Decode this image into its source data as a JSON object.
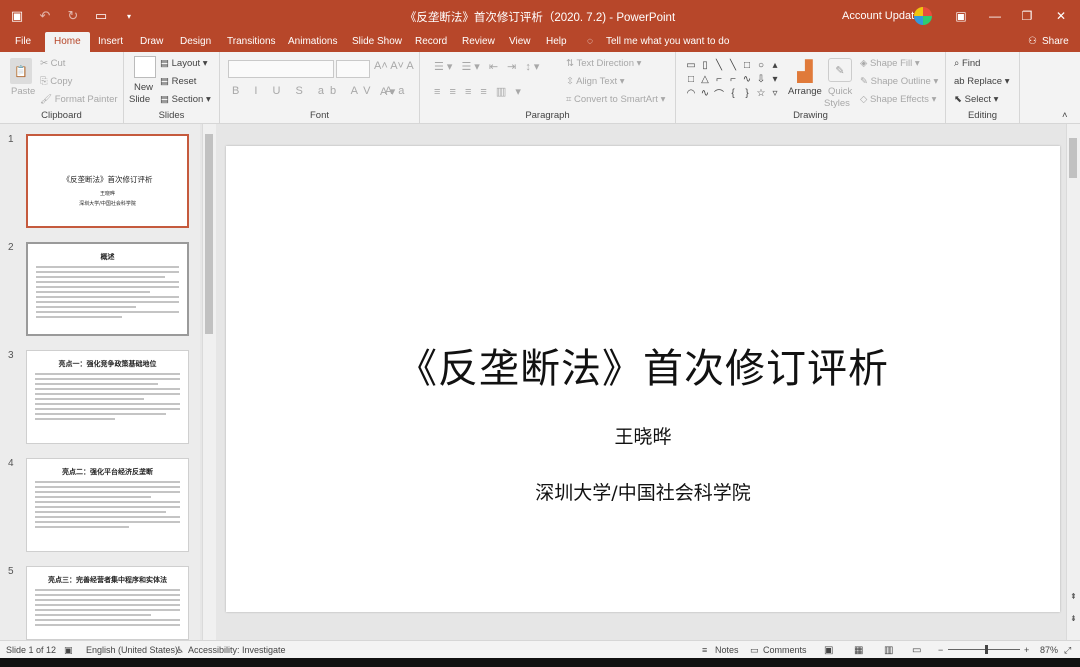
{
  "window": {
    "title": "《反垄断法》首次修订评析（2020. 7.2)  -  PowerPoint",
    "account": "Account Update"
  },
  "tabs": [
    "File",
    "Home",
    "Insert",
    "Draw",
    "Design",
    "Transitions",
    "Animations",
    "Slide Show",
    "Record",
    "Review",
    "View",
    "Help"
  ],
  "tell_me": "Tell me what you want to do",
  "share": "Share",
  "ribbon": {
    "clipboard": {
      "paste": "Paste",
      "cut": "Cut",
      "copy": "Copy",
      "format_painter": "Format Painter",
      "label": "Clipboard"
    },
    "slides": {
      "new_slide_1": "New",
      "new_slide_2": "Slide",
      "layout": "Layout",
      "reset": "Reset",
      "section": "Section",
      "label": "Slides"
    },
    "font": {
      "label": "Font"
    },
    "paragraph": {
      "text_direction": "Text Direction",
      "align_text": "Align Text",
      "convert_smartart": "Convert to SmartArt",
      "label": "Paragraph"
    },
    "drawing": {
      "arrange": "Arrange",
      "quick_styles_1": "Quick",
      "quick_styles_2": "Styles",
      "shape_fill": "Shape Fill",
      "shape_outline": "Shape Outline",
      "shape_effects": "Shape Effects",
      "label": "Drawing"
    },
    "editing": {
      "find": "Find",
      "replace": "Replace",
      "select": "Select",
      "label": "Editing"
    }
  },
  "thumbnails": [
    {
      "num": "1",
      "title": "《反垄断法》首次修订评析",
      "sub1": "王晓晔",
      "sub2": "深圳大学/中国社会科学院"
    },
    {
      "num": "2",
      "title": "概述"
    },
    {
      "num": "3",
      "title": "亮点一：强化竞争政策基础地位"
    },
    {
      "num": "4",
      "title": "亮点二：强化平台经济反垄断"
    },
    {
      "num": "5",
      "title": "亮点三：完善经营者集中程序和实体法"
    }
  ],
  "slide": {
    "title": "《反垄断法》首次修订评析",
    "author": "王晓晔",
    "affiliation": "深圳大学/中国社会科学院"
  },
  "status": {
    "slide_of": "Slide 1 of 12",
    "language": "English (United States)",
    "accessibility": "Accessibility: Investigate",
    "notes": "Notes",
    "comments": "Comments",
    "zoom": "87%"
  }
}
